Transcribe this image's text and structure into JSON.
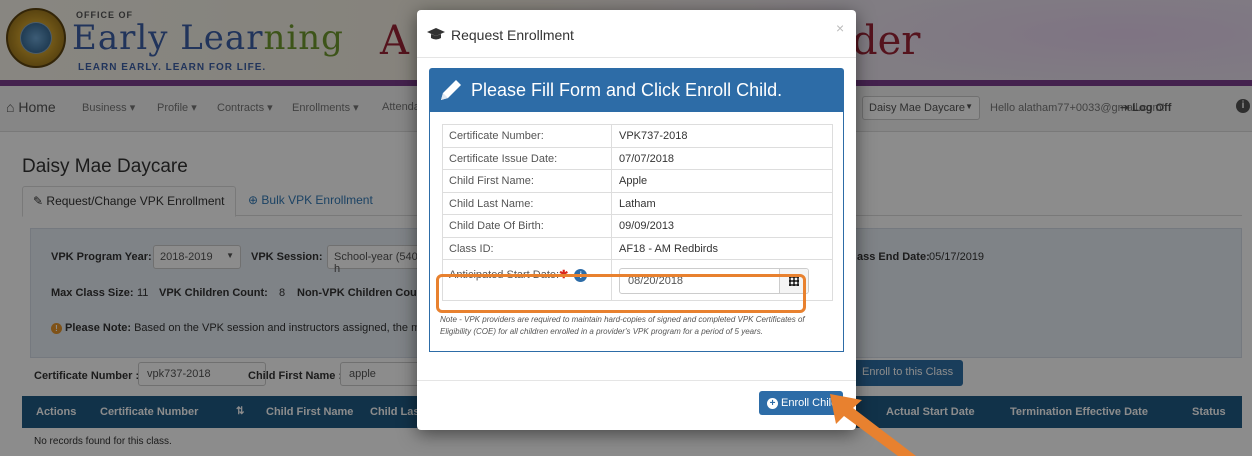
{
  "header": {
    "office_of": "OFFICE OF",
    "logo_main_a": "Early Lear",
    "logo_main_b": "ning",
    "tagline": "LEARN EARLY. LEARN FOR LIFE.",
    "app_title_left": "A",
    "app_title_right": "der"
  },
  "nav": {
    "home": "Home",
    "items": [
      "Business ▾",
      "Profile ▾",
      "Contracts ▾",
      "Enrollments ▾",
      "Attenda"
    ],
    "provider_select": "Daisy Mae Daycare",
    "hello": "Hello alatham77+0033@gmail.com!",
    "log_off": "Log Off"
  },
  "page": {
    "provider_name": "Daisy Mae Daycare",
    "tabs": [
      "Request/Change VPK Enrollment",
      "Bulk VPK Enrollment"
    ]
  },
  "class_panel": {
    "program_year_label": "VPK Program Year:",
    "program_year_value": "2018-2019",
    "session_label": "VPK Session:",
    "session_value": "School-year (540 h",
    "class_end_label": "ass End Date:",
    "class_end_value": "05/17/2019",
    "max_class_label": "Max Class Size:",
    "max_class_value": "11",
    "vpk_count_label": "VPK Children Count:",
    "vpk_count_value": "8",
    "nonvpk_label": "Non-VPK Children Count:",
    "note_label": "Please Note:",
    "note_text": "Based on the VPK session and instructors assigned, the maxim"
  },
  "search": {
    "cert_label": "Certificate Number :",
    "cert_value": "vpk737-2018",
    "first_label": "Child First Name :",
    "first_value": "apple",
    "enroll_class_button": "Enroll to this Class"
  },
  "table": {
    "headers": [
      "Actions",
      "Certificate Number",
      "Child First Name",
      "Child Las",
      "Actual Start Date",
      "Termination Effective Date",
      "Status"
    ],
    "empty_text": "No records found for this class."
  },
  "modal": {
    "title": "Request Enrollment",
    "close": "×",
    "form_title": "Please Fill Form and Click Enroll Child.",
    "fields": [
      {
        "label": "Certificate Number:",
        "value": "VPK737-2018"
      },
      {
        "label": "Certificate Issue Date:",
        "value": "07/07/2018"
      },
      {
        "label": "Child First Name:",
        "value": "Apple"
      },
      {
        "label": "Child Last Name:",
        "value": "Latham"
      },
      {
        "label": "Child Date Of Birth:",
        "value": "09/09/2013"
      },
      {
        "label": "Class ID:",
        "value": "AF18 - AM Redbirds"
      }
    ],
    "start_date_label": "Anticipated Start Date:",
    "required_mark": "✱",
    "start_date_value": "08/20/2018",
    "disclaimer": "Note - VPK providers are required to maintain hard-copies of signed and completed VPK Certificates of Eligibility (COE) for all children enrolled in a provider's VPK program for a period of 5 years.",
    "enroll_button": "Enroll Child"
  },
  "colors": {
    "primary_blue": "#2d6ca7",
    "table_header": "#1f5b86",
    "highlight_orange": "#e8812f",
    "required_red": "#d9261c"
  }
}
